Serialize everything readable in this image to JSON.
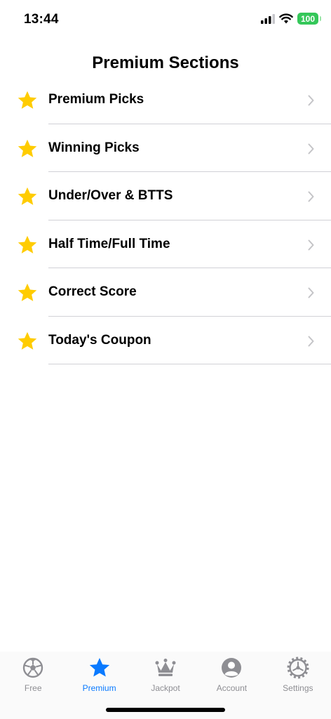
{
  "status_bar": {
    "time": "13:44",
    "battery": "100"
  },
  "header": {
    "title": "Premium Sections"
  },
  "sections": [
    {
      "label": "Premium Picks",
      "icon": "star-icon"
    },
    {
      "label": "Winning Picks",
      "icon": "star-icon"
    },
    {
      "label": "Under/Over & BTTS",
      "icon": "star-icon"
    },
    {
      "label": "Half Time/Full Time",
      "icon": "star-icon"
    },
    {
      "label": "Correct Score",
      "icon": "star-icon"
    },
    {
      "label": "Today's Coupon",
      "icon": "star-icon"
    }
  ],
  "tabs": [
    {
      "label": "Free",
      "icon": "soccer-ball-icon",
      "active": false
    },
    {
      "label": "Premium",
      "icon": "star-icon",
      "active": true
    },
    {
      "label": "Jackpot",
      "icon": "crown-icon",
      "active": false
    },
    {
      "label": "Account",
      "icon": "person-circle-icon",
      "active": false
    },
    {
      "label": "Settings",
      "icon": "gear-icon",
      "active": false
    }
  ],
  "colors": {
    "accent": "#0a7aff",
    "star": "#ffcc00",
    "inactive": "#8e8e93",
    "battery": "#34c759"
  }
}
